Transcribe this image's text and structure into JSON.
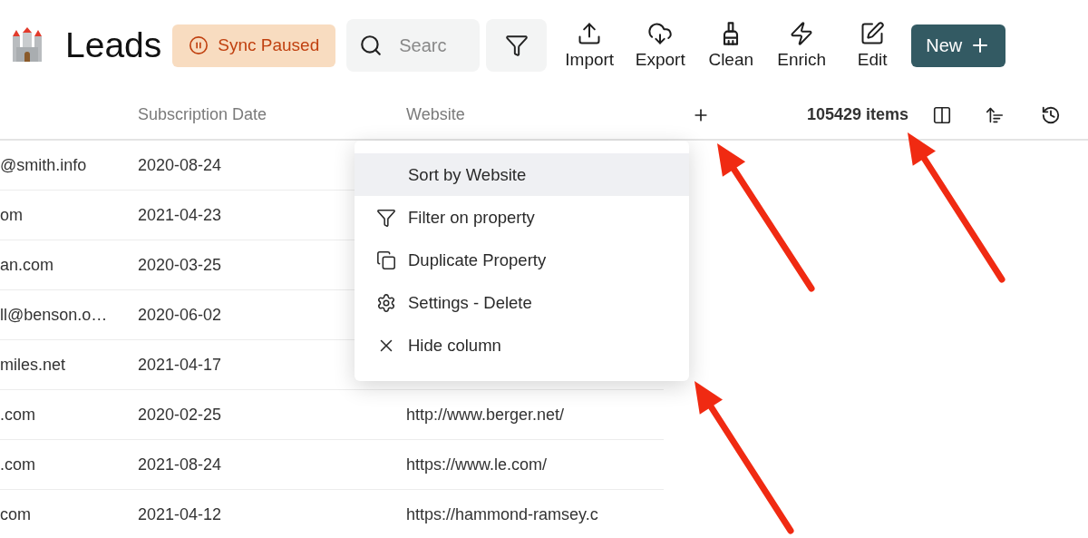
{
  "header": {
    "title": "Leads",
    "sync_badge": {
      "label": "Sync Paused",
      "paused": true
    },
    "search": {
      "placeholder": "Searc"
    },
    "toolbar": [
      {
        "label": "Import",
        "kind": "import"
      },
      {
        "label": "Export",
        "kind": "export"
      },
      {
        "label": "Clean",
        "kind": "clean"
      },
      {
        "label": "Enrich",
        "kind": "enrich"
      },
      {
        "label": "Edit",
        "kind": "edit"
      }
    ],
    "new_button": "New"
  },
  "table": {
    "columns": [
      {
        "label": "Subscription Date"
      },
      {
        "label": "Website"
      }
    ],
    "item_count": "105429 items",
    "rows": [
      {
        "column_1": "@smith.info",
        "subscription_date": "2020-08-24"
      },
      {
        "column_1": "om",
        "subscription_date": "2021-04-23"
      },
      {
        "column_1": "an.com",
        "subscription_date": "2020-03-25"
      },
      {
        "column_1": "ll@benson.o…",
        "subscription_date": "2020-06-02"
      },
      {
        "column_1": "miles.net",
        "subscription_date": "2021-04-17"
      },
      {
        "column_1": ".com",
        "subscription_date": "2020-02-25",
        "website": "http://www.berger.net/"
      },
      {
        "column_1": ".com",
        "subscription_date": "2021-08-24",
        "website": "https://www.le.com/"
      },
      {
        "column_1": "com",
        "subscription_date": "2021-04-12",
        "website": "https://hammond-ramsey.c"
      }
    ]
  },
  "column_menu": {
    "items": [
      {
        "label": "Sort by Website",
        "kind": "sort",
        "selected": true
      },
      {
        "label": "Filter on property",
        "kind": "filter",
        "selected": false
      },
      {
        "label": "Duplicate Property",
        "kind": "duplicate",
        "selected": false
      },
      {
        "label": "Settings - Delete",
        "kind": "settings",
        "selected": false
      },
      {
        "label": "Hide column",
        "kind": "hide",
        "selected": false
      }
    ]
  }
}
